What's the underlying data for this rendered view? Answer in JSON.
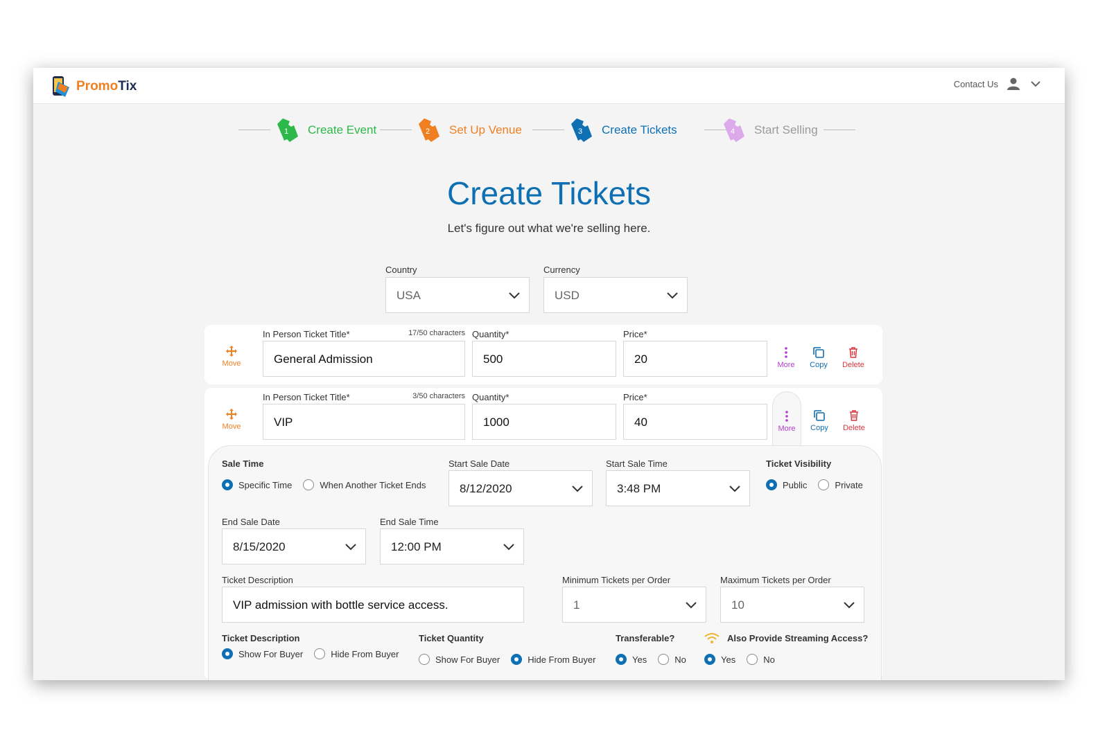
{
  "header": {
    "brand_part1": "Promo",
    "brand_part2": "Tix",
    "contact_label": "Contact Us"
  },
  "steps": [
    {
      "num": "1",
      "label": "Create Event",
      "color": "#2db84a"
    },
    {
      "num": "2",
      "label": "Set Up Venue",
      "color": "#f07f22"
    },
    {
      "num": "3",
      "label": "Create Tickets",
      "color": "#0f6fb3"
    },
    {
      "num": "4",
      "label": "Start Selling",
      "color": "#d9a4e8"
    }
  ],
  "page": {
    "title": "Create Tickets",
    "subtitle": "Let's figure out what we're selling here."
  },
  "country": {
    "label": "Country",
    "value": "USA"
  },
  "currency": {
    "label": "Currency",
    "value": "USD"
  },
  "tickets": [
    {
      "move_label": "Move",
      "title_label": "In Person Ticket Title*",
      "char_count": "17/50 characters",
      "title": "General Admission",
      "quantity_label": "Quantity*",
      "quantity": "500",
      "price_label": "Price*",
      "price": "20",
      "more_label": "More",
      "copy_label": "Copy",
      "delete_label": "Delete"
    },
    {
      "move_label": "Move",
      "title_label": "In Person Ticket Title*",
      "char_count": "3/50 characters",
      "title": "VIP",
      "quantity_label": "Quantity*",
      "quantity": "1000",
      "price_label": "Price*",
      "price": "40",
      "more_label": "More",
      "copy_label": "Copy",
      "delete_label": "Delete"
    }
  ],
  "details": {
    "sale_time": {
      "label": "Sale Time",
      "options": [
        "Specific Time",
        "When Another Ticket Ends"
      ],
      "selected": 0
    },
    "start_sale_date": {
      "label": "Start Sale Date",
      "value": "8/12/2020"
    },
    "start_sale_time": {
      "label": "Start Sale Time",
      "value": "3:48 PM"
    },
    "visibility": {
      "label": "Ticket Visibility",
      "options": [
        "Public",
        "Private"
      ],
      "selected": 0
    },
    "end_sale_date": {
      "label": "End Sale Date",
      "value": "8/15/2020"
    },
    "end_sale_time": {
      "label": "End Sale Time",
      "value": "12:00 PM"
    },
    "description": {
      "label": "Ticket Description",
      "value": "VIP admission with bottle service access."
    },
    "min_per_order": {
      "label": "Minimum Tickets per Order",
      "value": "1"
    },
    "max_per_order": {
      "label": "Maximum Tickets per Order",
      "value": "10"
    },
    "desc_visibility": {
      "label": "Ticket Description",
      "options": [
        "Show For Buyer",
        "Hide From Buyer"
      ],
      "selected": 0
    },
    "qty_visibility": {
      "label": "Ticket Quantity",
      "options": [
        "Show For Buyer",
        "Hide From Buyer"
      ],
      "selected": 1
    },
    "transferable": {
      "label": "Transferable?",
      "options": [
        "Yes",
        "No"
      ],
      "selected": 0
    },
    "streaming": {
      "label": "Also Provide Streaming Access?",
      "options": [
        "Yes",
        "No"
      ],
      "selected": 0
    }
  },
  "colors": {
    "accent": "#0f6fb3",
    "orange": "#f07f22",
    "purple": "#b03fd0",
    "red": "#d9363e",
    "wifi": "#f2b42c"
  }
}
